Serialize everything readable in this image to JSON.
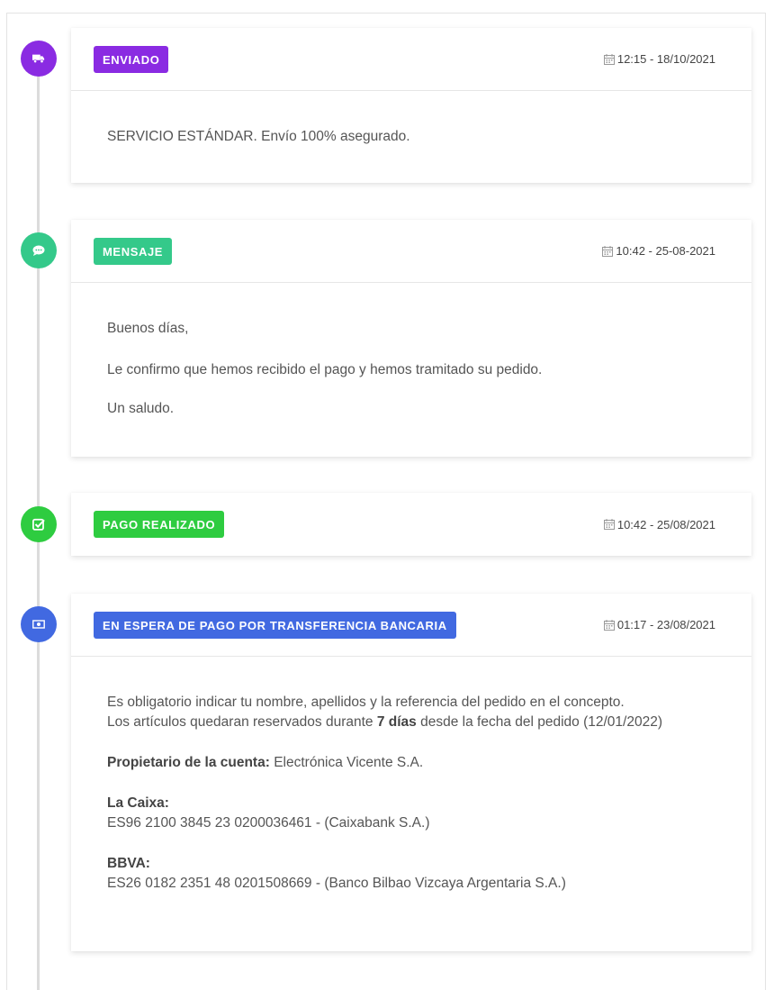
{
  "timeline": [
    {
      "badge": "ENVIADO",
      "datetime": "12:15 - 18/10/2021",
      "color": "#8a2be2",
      "icon": "truck-icon",
      "body": "SERVICIO ESTÁNDAR. Envío 100% asegurado."
    },
    {
      "badge": "MENSAJE",
      "datetime": "10:42 - 25-08-2021",
      "color": "#34c98a",
      "icon": "comment-icon",
      "body": {
        "greeting": "Buenos días,",
        "line": "Le confirmo que hemos recibido el pago y hemos tramitado su pedido.",
        "closing": "Un saludo."
      }
    },
    {
      "badge": "PAGO REALIZADO",
      "datetime": "10:42 - 25/08/2021",
      "color": "#2ecc40",
      "icon": "check-square-icon"
    },
    {
      "badge": "EN ESPERA DE PAGO POR TRANSFERENCIA BANCARIA",
      "datetime": "01:17 - 23/08/2021",
      "color": "#4169e1",
      "icon": "money-bill-icon",
      "body": {
        "line1": "Es obligatorio indicar tu nombre, apellidos y la referencia del pedido en el concepto.",
        "line2_pre": "Los artículos quedaran reservados durante ",
        "line2_bold": "7 días",
        "line2_post": " desde la fecha del pedido (12/01/2022)",
        "owner_label": "Propietario de la cuenta:",
        "owner_value": " Electrónica Vicente S.A.",
        "bank1_label": "La Caixa:",
        "bank1_iban": "ES96 2100 3845 23 0200036461 - (Caixabank S.A.)",
        "bank2_label": "BBVA:",
        "bank2_iban": "ES26 0182 2351 48 0201508669 - (Banco Bilbao Vizcaya Argentaria S.A.)"
      }
    }
  ]
}
